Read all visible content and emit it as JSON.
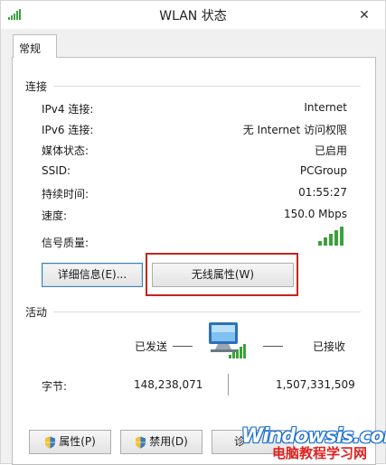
{
  "window": {
    "title": "WLAN 状态",
    "close_glyph": "✕"
  },
  "tab": {
    "label": "常规"
  },
  "connection": {
    "heading": "连接",
    "rows": [
      {
        "label": "IPv4 连接:",
        "value": "Internet"
      },
      {
        "label": "IPv6 连接:",
        "value": "无 Internet 访问权限"
      },
      {
        "label": "媒体状态:",
        "value": "已启用"
      },
      {
        "label": "SSID:",
        "value": "PCGroup"
      },
      {
        "label": "持续时间:",
        "value": "01:55:27"
      },
      {
        "label": "速度:",
        "value": "150.0 Mbps"
      }
    ],
    "signal_label": "信号质量:",
    "signal_level": "5/5",
    "details_button": "详细信息(E)...",
    "wireless_props_button": "无线属性(W)"
  },
  "activity": {
    "heading": "活动",
    "sent_label": "已发送",
    "received_label": "已接收",
    "bytes_label": "字节:",
    "bytes_sent": "148,238,071",
    "bytes_received": "1,507,331,509"
  },
  "buttons": {
    "properties": "属性(P)",
    "disable": "禁用(D)",
    "diagnose": "诊"
  },
  "watermark": {
    "line1": "Windowsis.com",
    "line2": "电脑教程学习网"
  },
  "colors": {
    "signal_green": "#3aa23a",
    "highlight_red": "#c8231e"
  }
}
